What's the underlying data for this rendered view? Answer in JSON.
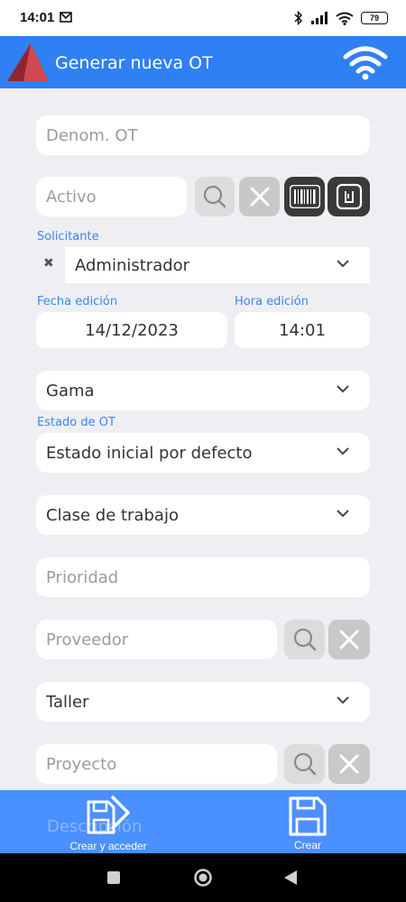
{
  "status": {
    "time": "14:01",
    "battery": "79"
  },
  "appbar": {
    "title": "Generar nueva OT"
  },
  "form": {
    "denom_placeholder": "Denom. OT",
    "activo_placeholder": "Activo",
    "solicitante_label": "Solicitante",
    "solicitante_value": "Administrador",
    "fecha_label": "Fecha edición",
    "fecha_value": "14/12/2023",
    "hora_label": "Hora edición",
    "hora_value": "14:01",
    "gama_placeholder": "Gama",
    "estado_label": "Estado de OT",
    "estado_value": "Estado inicial por defecto",
    "clase_placeholder": "Clase de trabajo",
    "prioridad_placeholder": "Prioridad",
    "proveedor_placeholder": "Proveedor",
    "taller_placeholder": "Taller",
    "proyecto_placeholder": "Proyecto",
    "descripcion_placeholder": "Descripción"
  },
  "bottom": {
    "create_access_label": "Crear y acceder",
    "create_label": "Crear"
  },
  "colors": {
    "primary": "#2f80f5",
    "bottom_bar": "#4b90ff",
    "label": "#3b86ed",
    "background": "#efeef3"
  }
}
